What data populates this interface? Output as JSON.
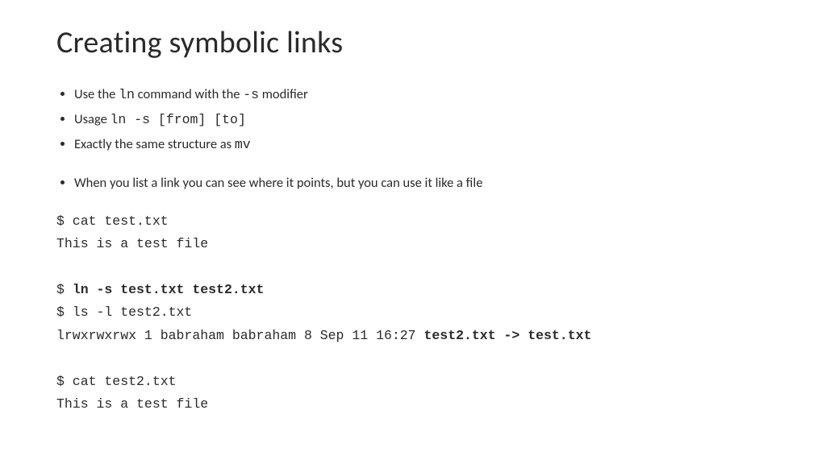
{
  "title": "Creating symbolic links",
  "bullets": {
    "b1a": "Use the ",
    "b1b": "ln",
    "b1c": " command with the ",
    "b1d": "-s",
    "b1e": " modifier",
    "b2a": "Usage ",
    "b2b": "ln -s [from] [to]",
    "b3a": "Exactly the same structure as  ",
    "b3b": "mv",
    "b4": "When you list a link you can see where it points, but you can use it like a file"
  },
  "term": {
    "l1": "$ cat test.txt",
    "l2": "This is a test file",
    "l3a": "$ ",
    "l3b": "ln -s test.txt test2.txt",
    "l4": "$ ls -l test2.txt",
    "l5a": "lrwxrwxrwx 1 babraham babraham 8 Sep 11 16:27 ",
    "l5b": "test2.txt -> test.txt",
    "l6": "$ cat test2.txt",
    "l7": "This is a test file"
  }
}
